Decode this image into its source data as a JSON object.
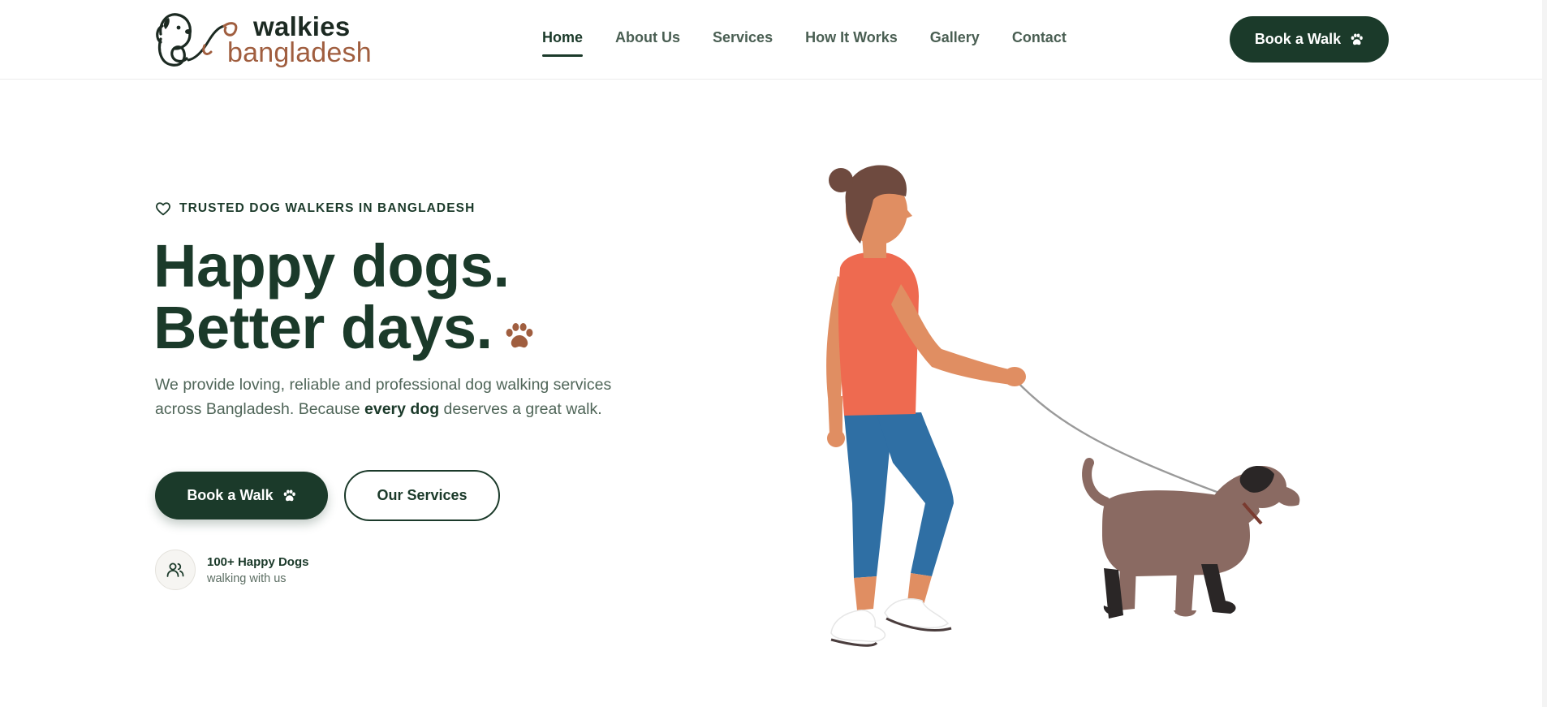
{
  "header": {
    "logo": {
      "line1": "walkies",
      "line2": "bangladesh",
      "icon": "dog-leash-logo-icon"
    },
    "nav": [
      {
        "label": "Home",
        "active": true
      },
      {
        "label": "About Us",
        "active": false
      },
      {
        "label": "Services",
        "active": false
      },
      {
        "label": "How It Works",
        "active": false
      },
      {
        "label": "Gallery",
        "active": false
      },
      {
        "label": "Contact",
        "active": false
      }
    ],
    "cta_label": "Book a Walk",
    "cta_icon": "paw-icon"
  },
  "hero": {
    "eyebrow_icon": "heart-icon",
    "eyebrow": "TRUSTED DOG WALKERS IN BANGLADESH",
    "headline_line1": "Happy dogs.",
    "headline_line2": "Better days.",
    "headline_icon": "paw-icon",
    "description_pre": "We provide loving, reliable and professional dog walking services across Bangladesh. Because ",
    "description_bold": "every dog",
    "description_post": " deserves a great walk.",
    "primary_button": "Book a Walk",
    "secondary_button": "Our Services",
    "stat_icon": "users-icon",
    "stat_title": "100+ Happy Dogs",
    "stat_subtitle": "walking with us",
    "illustration": "woman-walking-dog-illustration"
  },
  "colors": {
    "primary": "#1b3a2a",
    "accent": "#a05e3f",
    "text_muted": "#4f6558",
    "background": "#ffffff"
  }
}
